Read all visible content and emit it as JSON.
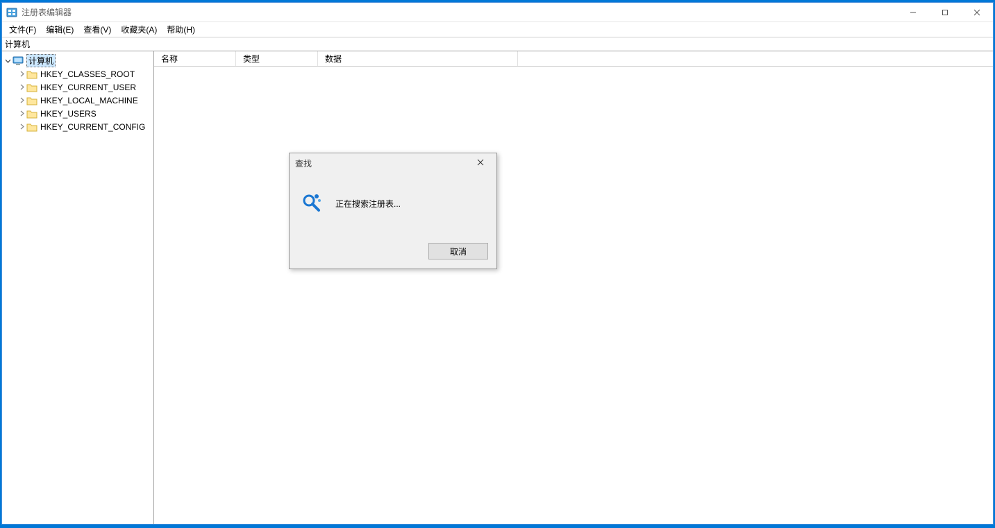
{
  "titlebar": {
    "title": "注册表编辑器"
  },
  "menubar": {
    "file": "文件(F)",
    "edit": "编辑(E)",
    "view": "查看(V)",
    "favorites": "收藏夹(A)",
    "help": "帮助(H)"
  },
  "addressbar": {
    "path": "计算机"
  },
  "tree": {
    "root": "计算机",
    "children": [
      {
        "label": "HKEY_CLASSES_ROOT"
      },
      {
        "label": "HKEY_CURRENT_USER"
      },
      {
        "label": "HKEY_LOCAL_MACHINE"
      },
      {
        "label": "HKEY_USERS"
      },
      {
        "label": "HKEY_CURRENT_CONFIG"
      }
    ]
  },
  "columns": {
    "name": "名称",
    "type": "类型",
    "data": "数据"
  },
  "dialog": {
    "title": "查找",
    "status": "正在搜索注册表...",
    "cancel": "取消"
  }
}
